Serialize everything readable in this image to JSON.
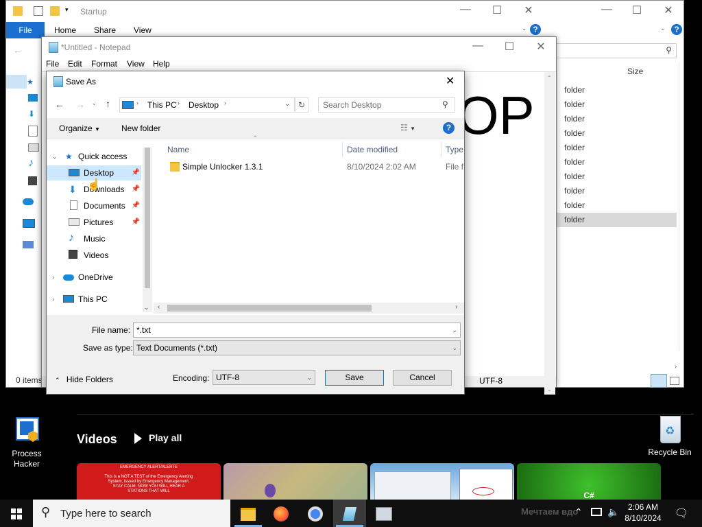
{
  "explorer": {
    "title": "Startup",
    "ribbon": {
      "file": "File",
      "home": "Home",
      "share": "Share",
      "view": "View"
    },
    "size_header": "Size",
    "folder_rows": [
      "folder",
      "folder",
      "folder",
      "folder",
      "folder",
      "folder",
      "folder",
      "folder",
      "folder",
      "folder"
    ],
    "status_items": "0 items"
  },
  "notepad": {
    "title": "*Untitled - Notepad",
    "menu": {
      "file": "File",
      "edit": "Edit",
      "format": "Format",
      "view": "View",
      "help": "Help"
    },
    "content_text": "OP",
    "status_encoding": "UTF-8"
  },
  "dialog": {
    "title": "Save As",
    "breadcrumb": {
      "this_pc": "This PC",
      "desktop": "Desktop"
    },
    "search_placeholder": "Search Desktop",
    "organize": "Organize",
    "new_folder": "New folder",
    "nav": {
      "quick_access": "Quick access",
      "desktop": "Desktop",
      "downloads": "Downloads",
      "documents": "Documents",
      "pictures": "Pictures",
      "music": "Music",
      "videos": "Videos",
      "onedrive": "OneDrive",
      "this_pc": "This PC"
    },
    "columns": {
      "name": "Name",
      "date_modified": "Date modified",
      "type": "Type"
    },
    "files": [
      {
        "name": "Simple Unlocker 1.3.1",
        "date": "8/10/2024 2:02 AM",
        "type": "File fo"
      }
    ],
    "file_name_label": "File name:",
    "file_name_value": "*.txt",
    "save_type_label": "Save as type:",
    "save_type_value": "Text Documents (*.txt)",
    "hide_folders": "Hide Folders",
    "encoding_label": "Encoding:",
    "encoding_value": "UTF-8",
    "save": "Save",
    "cancel": "Cancel"
  },
  "desktop": {
    "process_hacker": "Process\nHacker",
    "recycle_bin": "Recycle Bin",
    "videos_heading": "Videos",
    "play_all": "Play all",
    "thumb1_title": "EMERGENCY ALERT/ALERTE",
    "thumb1_body": "This is a NOT A TEST of the Emergency Alerting System, issued by Emergency Management. STAY CALM. NOW YOU WILL HEAR A STATIONS THAT WILL",
    "thumb4_text": "C#",
    "thumb4_sub": "Мечтаем вдо"
  },
  "taskbar": {
    "search_placeholder": "Type here to search",
    "time": "2:06 AM",
    "date": "8/10/2024"
  }
}
